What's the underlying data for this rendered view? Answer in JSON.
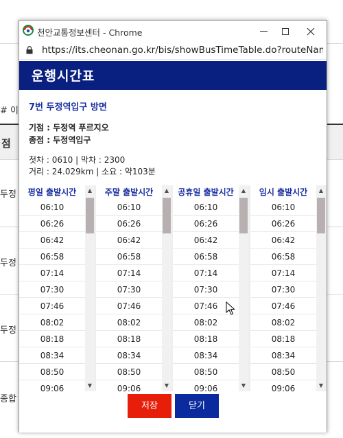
{
  "window": {
    "title": "천안교통정보센터 - Chrome",
    "url": "https://its.cheonan.go.kr/bis/showBusTimeTable.do?routeNam..."
  },
  "background": {
    "fragments": [
      "# 이",
      "점",
      "두정",
      "두정",
      "두정",
      "종합"
    ]
  },
  "popup": {
    "header_title": "운행시간표",
    "route_direction": "7번 두정역입구 방면",
    "origin": "기점 : 두정역 푸르지오",
    "terminus": "종점 : 두정역입구",
    "first_last": "첫차 : 0610 | 막차 : 2300",
    "distance_time": "거리 : 24.029km | 소요 : 약103분"
  },
  "timetables": [
    {
      "header": "평일 출발시간",
      "times": [
        "06:10",
        "06:26",
        "06:42",
        "06:58",
        "07:14",
        "07:30",
        "07:46",
        "08:02",
        "08:18",
        "08:34",
        "08:50",
        "09:06"
      ]
    },
    {
      "header": "주말 출발시간",
      "times": [
        "06:10",
        "06:26",
        "06:42",
        "06:58",
        "07:14",
        "07:30",
        "07:46",
        "08:02",
        "08:18",
        "08:34",
        "08:50",
        "09:06"
      ]
    },
    {
      "header": "공휴일 출발시간",
      "times": [
        "06:10",
        "06:26",
        "06:42",
        "06:58",
        "07:14",
        "07:30",
        "07:46",
        "08:02",
        "08:18",
        "08:34",
        "08:50",
        "09:06"
      ]
    },
    {
      "header": "임시 출발시간",
      "times": [
        "06:10",
        "06:26",
        "06:42",
        "06:58",
        "07:14",
        "07:30",
        "07:46",
        "08:02",
        "08:18",
        "08:34",
        "08:50",
        "09:06"
      ]
    }
  ],
  "buttons": {
    "save_label": "저장",
    "close_label": "닫기"
  },
  "colors": {
    "header_band": "#0a2080",
    "route_text": "#1a2fa0",
    "save_button": "#e61e0a",
    "close_button": "#0b2a9e"
  }
}
